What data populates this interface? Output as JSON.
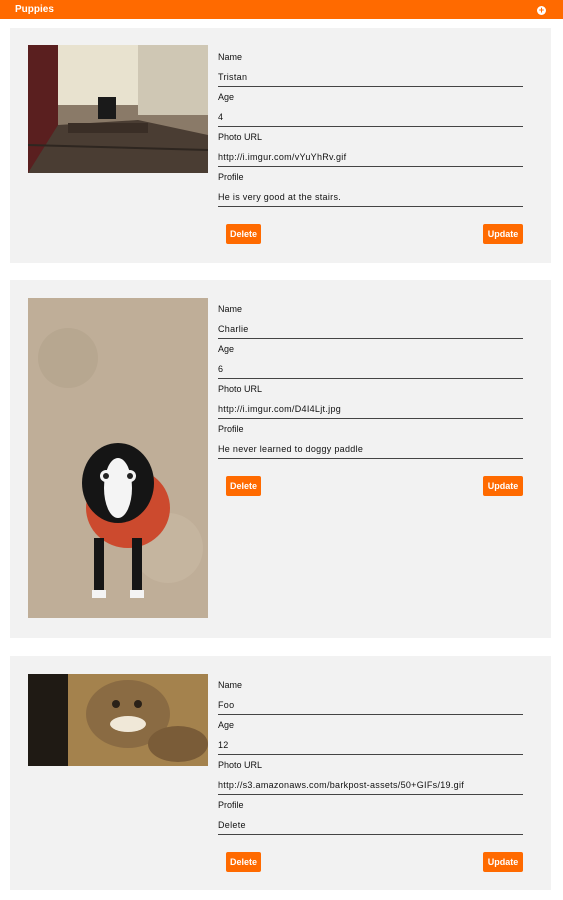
{
  "header": {
    "title": "Puppies",
    "add_icon": "plus-circle-icon"
  },
  "labels": {
    "name": "Name",
    "age": "Age",
    "photo_url": "Photo URL",
    "profile": "Profile",
    "delete": "Delete",
    "update": "Update"
  },
  "puppies": [
    {
      "name": "Tristan",
      "age": "4",
      "photo_url": "http://i.imgur.com/vYuYhRv.gif",
      "profile": "He is very good at the stairs."
    },
    {
      "name": "Charlie",
      "age": "6",
      "photo_url": "http://i.imgur.com/D4I4Ljt.jpg",
      "profile": "He never learned to doggy paddle"
    },
    {
      "name": "Foo",
      "age": "12",
      "photo_url": "http://s3.amazonaws.com/barkpost-assets/50+GIFs/19.gif",
      "profile": "Delete"
    }
  ],
  "colors": {
    "accent": "#ff6a00",
    "card_bg": "#f2f2f2"
  }
}
